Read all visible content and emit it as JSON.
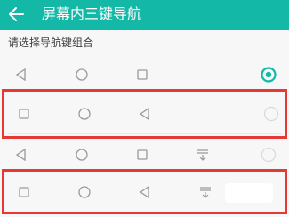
{
  "header": {
    "title": "屏幕内三键导航",
    "back_icon": "arrow-left-icon",
    "accent_color": "#14b8a6"
  },
  "section": {
    "label": "请选择导航键组合"
  },
  "options": [
    {
      "icons": [
        "back-triangle-icon",
        "home-circle-icon",
        "recent-square-icon"
      ],
      "selected": true
    },
    {
      "icons": [
        "recent-square-icon",
        "home-circle-icon",
        "back-triangle-icon"
      ],
      "selected": false,
      "highlighted": true
    },
    {
      "icons": [
        "back-triangle-icon",
        "home-circle-icon",
        "recent-square-icon",
        "notification-pulldown-icon"
      ],
      "selected": false
    },
    {
      "icons": [
        "recent-square-icon",
        "home-circle-icon",
        "back-triangle-icon",
        "notification-pulldown-icon"
      ],
      "selected": false,
      "highlighted": true
    }
  ],
  "highlight_color": "#e53935"
}
